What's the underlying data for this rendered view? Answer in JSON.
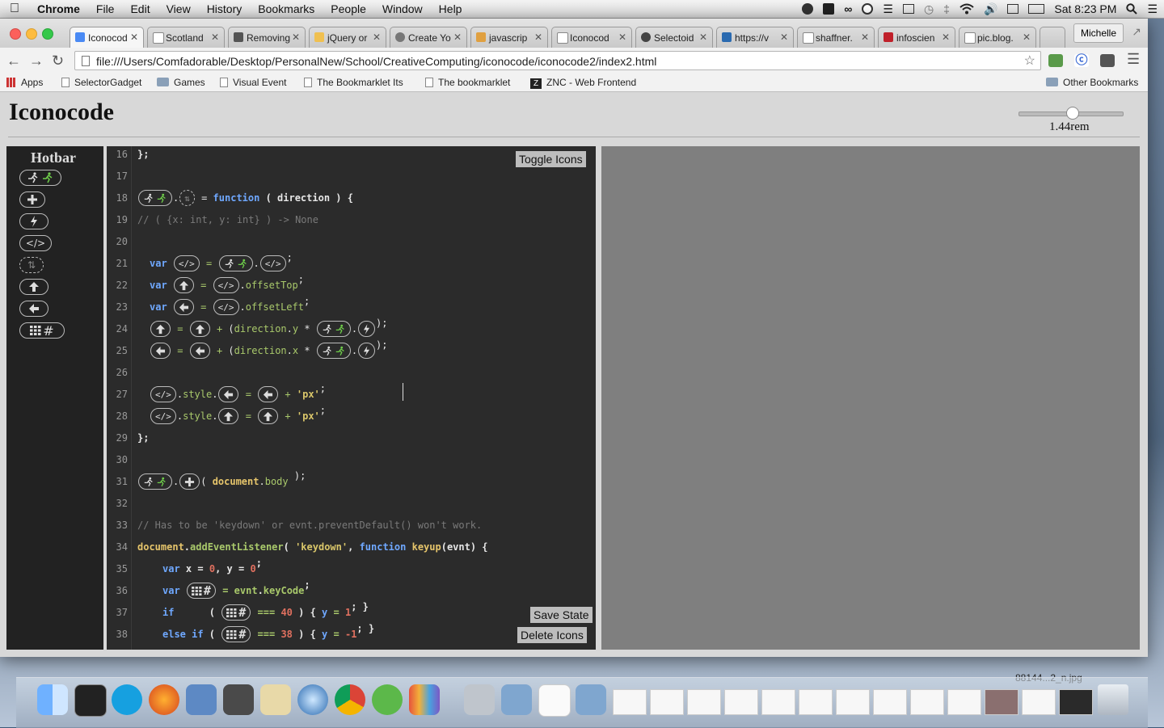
{
  "menubar": {
    "app": "Chrome",
    "items": [
      "File",
      "Edit",
      "View",
      "History",
      "Bookmarks",
      "People",
      "Window",
      "Help"
    ],
    "clock": "Sat 8:23 PM"
  },
  "browser": {
    "tabs": [
      {
        "label": "Iconocod"
      },
      {
        "label": "Scotland"
      },
      {
        "label": "Removing"
      },
      {
        "label": "jQuery or"
      },
      {
        "label": "Create Yo"
      },
      {
        "label": "javascrip"
      },
      {
        "label": "Iconocod"
      },
      {
        "label": "Selectoid"
      },
      {
        "label": "https://v"
      },
      {
        "label": "shaffner."
      },
      {
        "label": "infoscien"
      },
      {
        "label": "pic.blog."
      }
    ],
    "profile": "Michelle",
    "url": "file:///Users/Comfadorable/Desktop/PersonalNew/School/CreativeComputing/iconocode/iconocode2/index2.html",
    "bookmarks": [
      "Apps",
      "SelectorGadget",
      "Games",
      "Visual Event",
      "The Bookmarklet Its",
      "The bookmarklet",
      "ZNC - Web Frontend"
    ],
    "other_bookmarks": "Other Bookmarks"
  },
  "page": {
    "title": "Iconocode",
    "slider_value": "1.44rem",
    "hotbar_title": "Hotbar",
    "hotbar_icons": [
      "runner-icon",
      "plus-icon",
      "lightning-icon",
      "code-icon",
      "gesture-icon",
      "arrow-up-icon",
      "arrow-left-icon",
      "keyboard-grid-icon"
    ],
    "buttons": {
      "toggle_icons": "Toggle Icons",
      "save_state": "Save State",
      "delete_icons": "Delete Icons"
    }
  },
  "code": {
    "line_numbers": [
      "16",
      "17",
      "18",
      "19",
      "20",
      "21",
      "22",
      "23",
      "24",
      "25",
      "26",
      "27",
      "28",
      "29",
      "30",
      "31",
      "32",
      "33",
      "34",
      "35",
      "36",
      "37",
      "38"
    ],
    "l16": "};",
    "l18_fn": "function",
    "l18_arg": "( direction ) {",
    "l19": "// ( {x: int, y: int} ) -> None",
    "var": "var",
    "offsetTop": "offsetTop",
    "offsetLeft": "offsetLeft",
    "direction_y": "direction",
    "y": "y",
    "x": "x",
    "style": "style",
    "px": "'px'",
    "l29": "};",
    "document_body": "document",
    "body": "body",
    "l33": "// Has to be 'keydown' or evnt.preventDefault() won't work.",
    "document": "document",
    "addEventListener": "addEventListener",
    "keydown": "'keydown'",
    "function": "function",
    "keyup": "keyup",
    "evnt_arg": "(evnt) {",
    "l35_x": "x",
    "zero": "0",
    "l35_y": "y",
    "evnt": "evnt",
    "keyCode": "keyCode",
    "if": "if",
    "else_if": "else if",
    "forty": "40",
    "one": "1",
    "thirtyeight": "38",
    "neg_one": "-1"
  },
  "dock": {
    "file_label": "88144...2_n.jpg"
  }
}
